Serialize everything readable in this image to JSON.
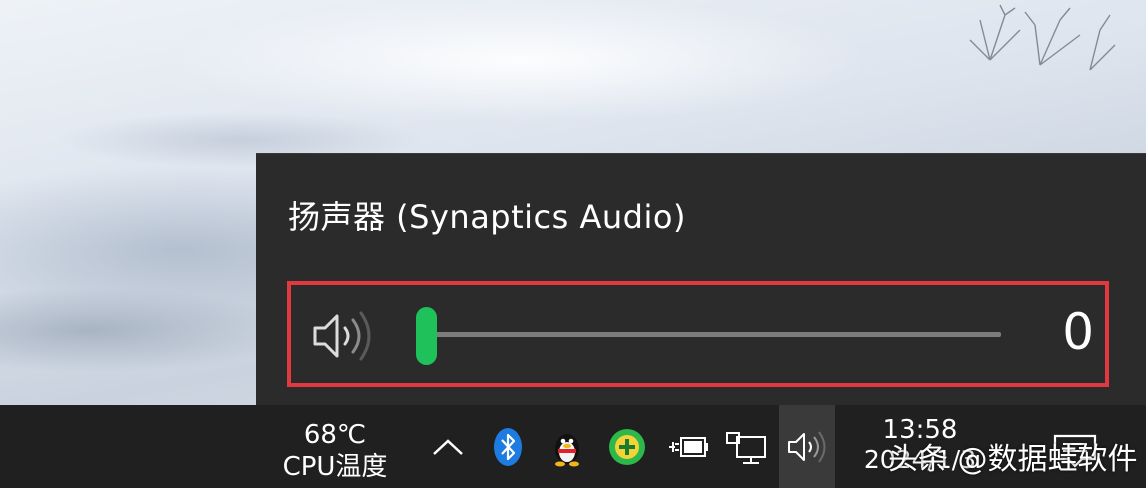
{
  "volume_flyout": {
    "device_name": "扬声器 (Synaptics Audio)",
    "speaker_icon": "speaker-volume-icon",
    "volume_value": "0",
    "volume_level": 0,
    "slider_color": "#1fc25a",
    "highlight_color": "#e2383f"
  },
  "taskbar": {
    "cpu_widget": {
      "temperature": "68℃",
      "label": "CPU温度"
    },
    "tray_icons": [
      "chevron-up-icon",
      "bluetooth-icon",
      "qq-penguin-icon",
      "green-plus-icon",
      "battery-plug-icon",
      "network-monitor-icon",
      "speaker-icon"
    ],
    "clock": {
      "time": "13:58",
      "date": "2024/1/3"
    },
    "notification_icon": "notification-icon"
  },
  "watermark": "头条 @数据蛙软件"
}
